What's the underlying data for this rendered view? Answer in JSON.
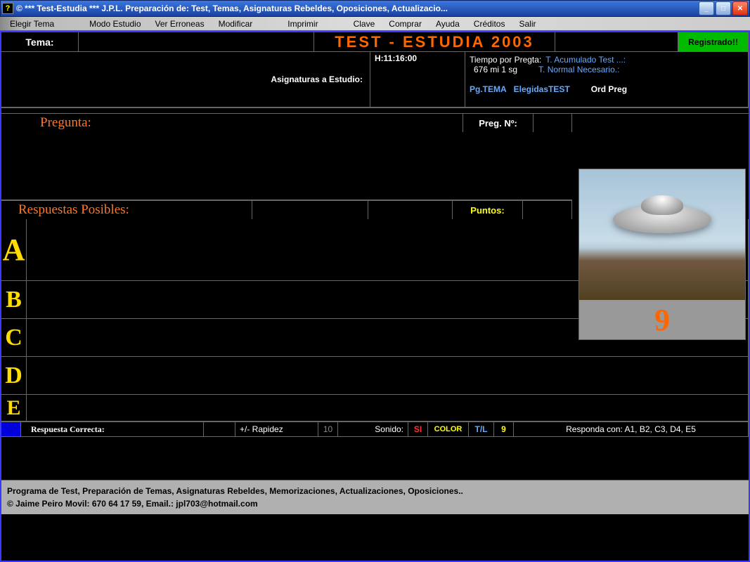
{
  "titlebar": {
    "icon": "?",
    "title": "©  *** Test-Estudia ***  J.P.L.   Preparación de: Test, Temas, Asignaturas Rebeldes, Oposiciones, Actualizacio..."
  },
  "menu": {
    "elegir_tema": "Elegir Tema",
    "modo_estudio": "Modo Estudio",
    "ver_erroneas": "Ver Erroneas",
    "modificar": "Modificar",
    "imprimir": "Imprimir",
    "clave": "Clave",
    "comprar": "Comprar",
    "ayuda": "Ayuda",
    "creditos": "Créditos",
    "salir": "Salir"
  },
  "header": {
    "tema_label": "Tema:",
    "tema_value": "",
    "app_title": "TEST -  ESTUDIA 2003",
    "registered": "Registrado!!"
  },
  "info": {
    "asignaturas_label": "Asignaturas a Estudio:",
    "time_label": "H:11:16:00",
    "tiempo_pregta": "Tiempo  por Pregta:",
    "tiempo_val": "676 mi  1 sg",
    "acumulado": "T. Acumulado Test ...:",
    "normal": "T. Normal Necesario.:",
    "pg_tema": "Pg.TEMA",
    "elegidas": "ElegidasTEST",
    "ord_preg": "Ord Preg"
  },
  "pregunta": {
    "label": "Pregunta:",
    "num_label": "Preg. Nº:",
    "num_value": ""
  },
  "respuestas": {
    "label": "Respuestas Posibles:",
    "puntos_label": "Puntos:",
    "puntos_value": "",
    "letters": {
      "a": "A",
      "b": "B",
      "c": "C",
      "d": "D",
      "e": "E"
    }
  },
  "counter": "9",
  "status": {
    "rc_label": "Respuesta Correcta:",
    "rc_value": "",
    "rapidez_label": "+/-  Rapidez",
    "rapidez_value": "10",
    "sonido_label": "Sonido:",
    "sonido_value": "SI",
    "color_label": "COLOR",
    "tl_label": "T/L",
    "tl_value": "9",
    "responda": "Responda con:  A1, B2, C3, D4, E5"
  },
  "footer": {
    "line1": "Programa de Test, Preparación de Temas, Asignaturas Rebeldes, Memorizaciones, Actualizaciones, Oposiciones..",
    "line2": "©  Jaime  Peiro  Movil: 670 64 17 59, Email.: jpl703@hotmail.com"
  }
}
